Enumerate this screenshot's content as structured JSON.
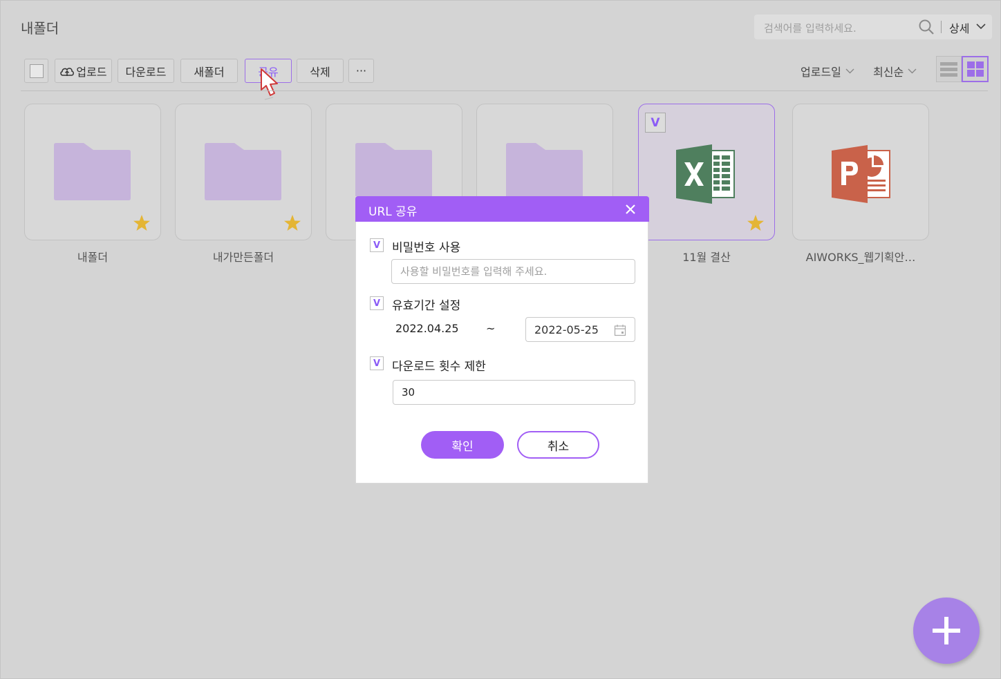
{
  "header": {
    "title": "내폴더",
    "search_placeholder": "검색어를 입력하세요.",
    "detail_label": "상세"
  },
  "toolbar": {
    "upload": "업로드",
    "download": "다운로드",
    "new_folder": "새폴더",
    "share": "공유",
    "delete": "삭제",
    "more": "···"
  },
  "sort": {
    "by": "업로드일",
    "order": "최신순"
  },
  "files": [
    {
      "name": "내폴더",
      "type": "folder",
      "starred": true
    },
    {
      "name": "내가만든폴더",
      "type": "folder",
      "starred": true
    },
    {
      "name": "",
      "type": "folder",
      "starred": false
    },
    {
      "name": "",
      "type": "folder",
      "starred": false
    },
    {
      "name": "11월 결산",
      "type": "excel",
      "starred": true,
      "checked": true,
      "check_mark": "V"
    },
    {
      "name": "AIWORKS_웹기획안…",
      "type": "powerpoint",
      "starred": false
    }
  ],
  "dialog": {
    "title": "URL 공유",
    "password": {
      "checked": true,
      "check_mark": "V",
      "label": "비밀번호 사용",
      "placeholder": "사용할 비밀번호를 입력해 주세요.",
      "value": ""
    },
    "validity": {
      "checked": true,
      "check_mark": "V",
      "label": "유효기간 설정",
      "start": "2022.04.25",
      "separator": "~",
      "end": "2022-05-25"
    },
    "download_limit": {
      "checked": true,
      "check_mark": "V",
      "label": "다운로드 횟수 제한",
      "value": "30"
    },
    "confirm": "확인",
    "cancel": "취소"
  },
  "colors": {
    "accent": "#a15ef5",
    "folder": "#c6b4db",
    "star": "#e4b535",
    "excel": "#4f7f5e",
    "powerpoint": "#c9624a",
    "fab": "#a782e7"
  }
}
